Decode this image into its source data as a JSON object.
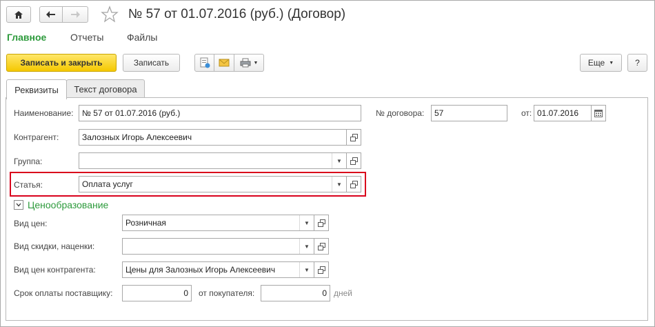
{
  "window": {
    "title": "№ 57 от 01.07.2016 (руб.) (Договор)"
  },
  "nav": {
    "main": "Главное",
    "reports": "Отчеты",
    "files": "Файлы"
  },
  "toolbar": {
    "save_close": "Записать и закрыть",
    "save": "Записать",
    "more": "Еще",
    "help": "?"
  },
  "tabs": [
    {
      "label": "Реквизиты"
    },
    {
      "label": "Текст договора"
    }
  ],
  "form": {
    "name_label": "Наименование:",
    "name_value": "№ 57 от 01.07.2016 (руб.)",
    "contract_no_label": "№ договора:",
    "contract_no_value": "57",
    "from_label": "от:",
    "from_value": "01.07.2016",
    "counterparty_label": "Контрагент:",
    "counterparty_value": "Залозных Игорь Алексеевич",
    "group_label": "Группа:",
    "group_value": "",
    "article_label": "Статья:",
    "article_value": "Оплата услуг"
  },
  "pricing": {
    "section_title": "Ценообразование",
    "price_type_label": "Вид цен:",
    "price_type_value": "Розничная",
    "discount_label": "Вид скидки, наценки:",
    "discount_value": "",
    "cp_price_label": "Вид цен контрагента:",
    "cp_price_value": "Цены для Залозных Игорь Алексеевич",
    "supplier_term_label": "Срок оплаты поставщику:",
    "supplier_term_value": "0",
    "buyer_label": "от покупателя:",
    "buyer_value": "0",
    "days_label": "дней"
  },
  "colors": {
    "accent_green": "#2c9a3b",
    "primary_yellow": "#f5c800",
    "highlight_red": "#d9001b"
  }
}
